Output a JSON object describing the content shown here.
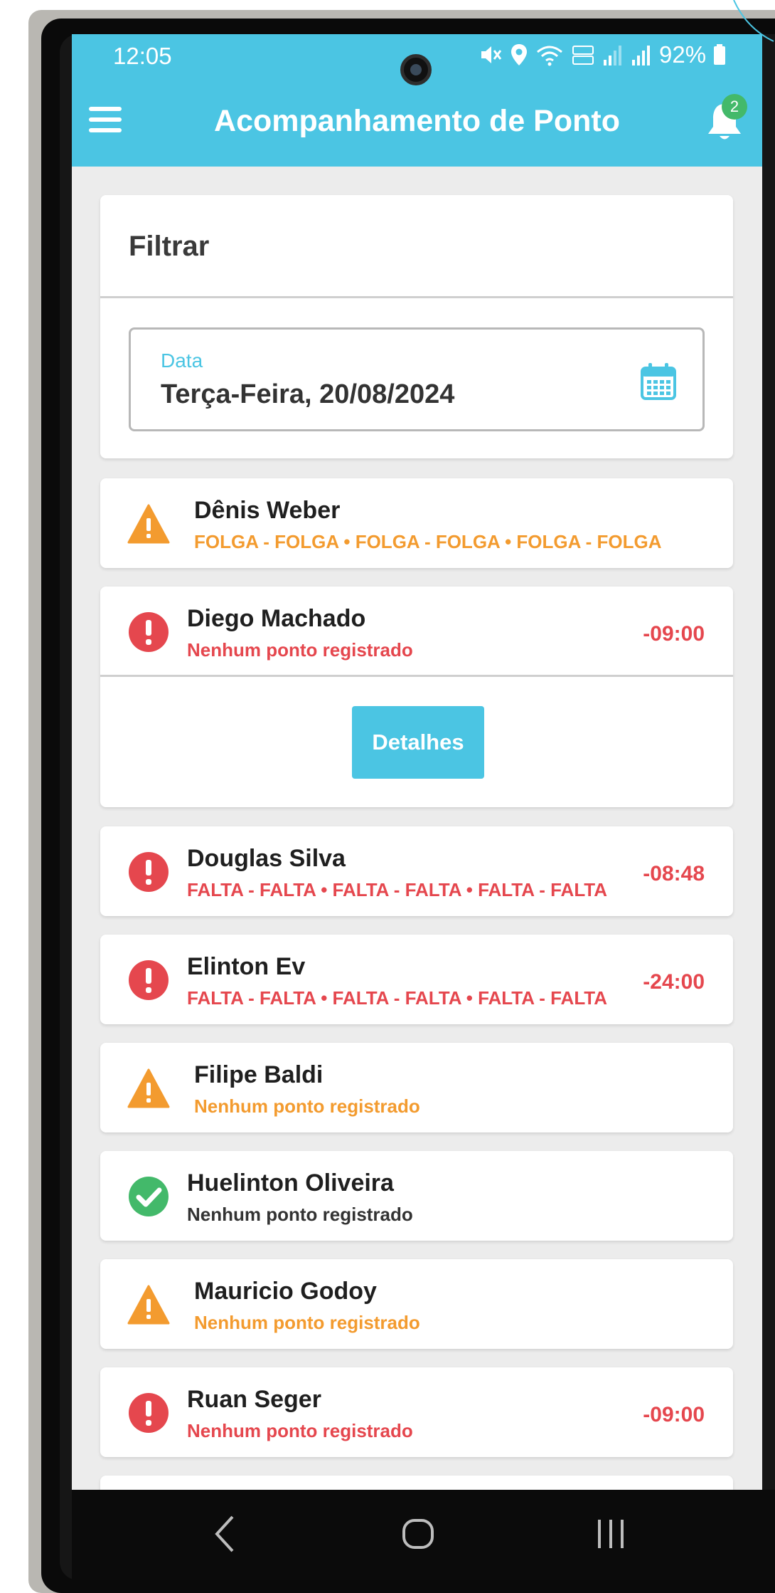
{
  "status_bar": {
    "time": "12:05",
    "battery": "92%"
  },
  "app_bar": {
    "title": "Acompanhamento de Ponto",
    "notification_count": "2"
  },
  "filter": {
    "title": "Filtrar",
    "date_label": "Data",
    "date_value": "Terça-Feira, 20/08/2024"
  },
  "employees": [
    {
      "name": "Dênis Weber",
      "status": "warning",
      "subtitle": "FOLGA - FOLGA • FOLGA - FOLGA • FOLGA - FOLGA",
      "balance": ""
    },
    {
      "name": "Diego Machado",
      "status": "error",
      "subtitle": "Nenhum ponto registrado",
      "balance": "-09:00",
      "details_label": "Detalhes"
    },
    {
      "name": "Douglas Silva",
      "status": "error",
      "subtitle": "FALTA - FALTA • FALTA - FALTA • FALTA - FALTA",
      "balance": "-08:48"
    },
    {
      "name": "Elinton Ev",
      "status": "error",
      "subtitle": "FALTA - FALTA • FALTA - FALTA • FALTA - FALTA",
      "balance": "-24:00"
    },
    {
      "name": "Filipe Baldi",
      "status": "warning",
      "subtitle": "Nenhum ponto registrado",
      "balance": ""
    },
    {
      "name": "Huelinton Oliveira",
      "status": "ok",
      "subtitle": "Nenhum ponto registrado",
      "balance": ""
    },
    {
      "name": "Mauricio Godoy",
      "status": "warning",
      "subtitle": "Nenhum ponto registrado",
      "balance": ""
    },
    {
      "name": "Ruan Seger",
      "status": "error",
      "subtitle": "Nenhum ponto registrado",
      "balance": "-09:00"
    }
  ],
  "colors": {
    "accent": "#4bc5e3",
    "warning": "#f39b2f",
    "error": "#e5474e",
    "ok": "#43b96a"
  },
  "icons": {
    "warning": "warning-triangle-icon",
    "error": "exclamation-circle-icon",
    "ok": "check-circle-icon",
    "menu": "hamburger-menu-icon",
    "notifications": "bell-icon",
    "date": "calendar-icon"
  }
}
